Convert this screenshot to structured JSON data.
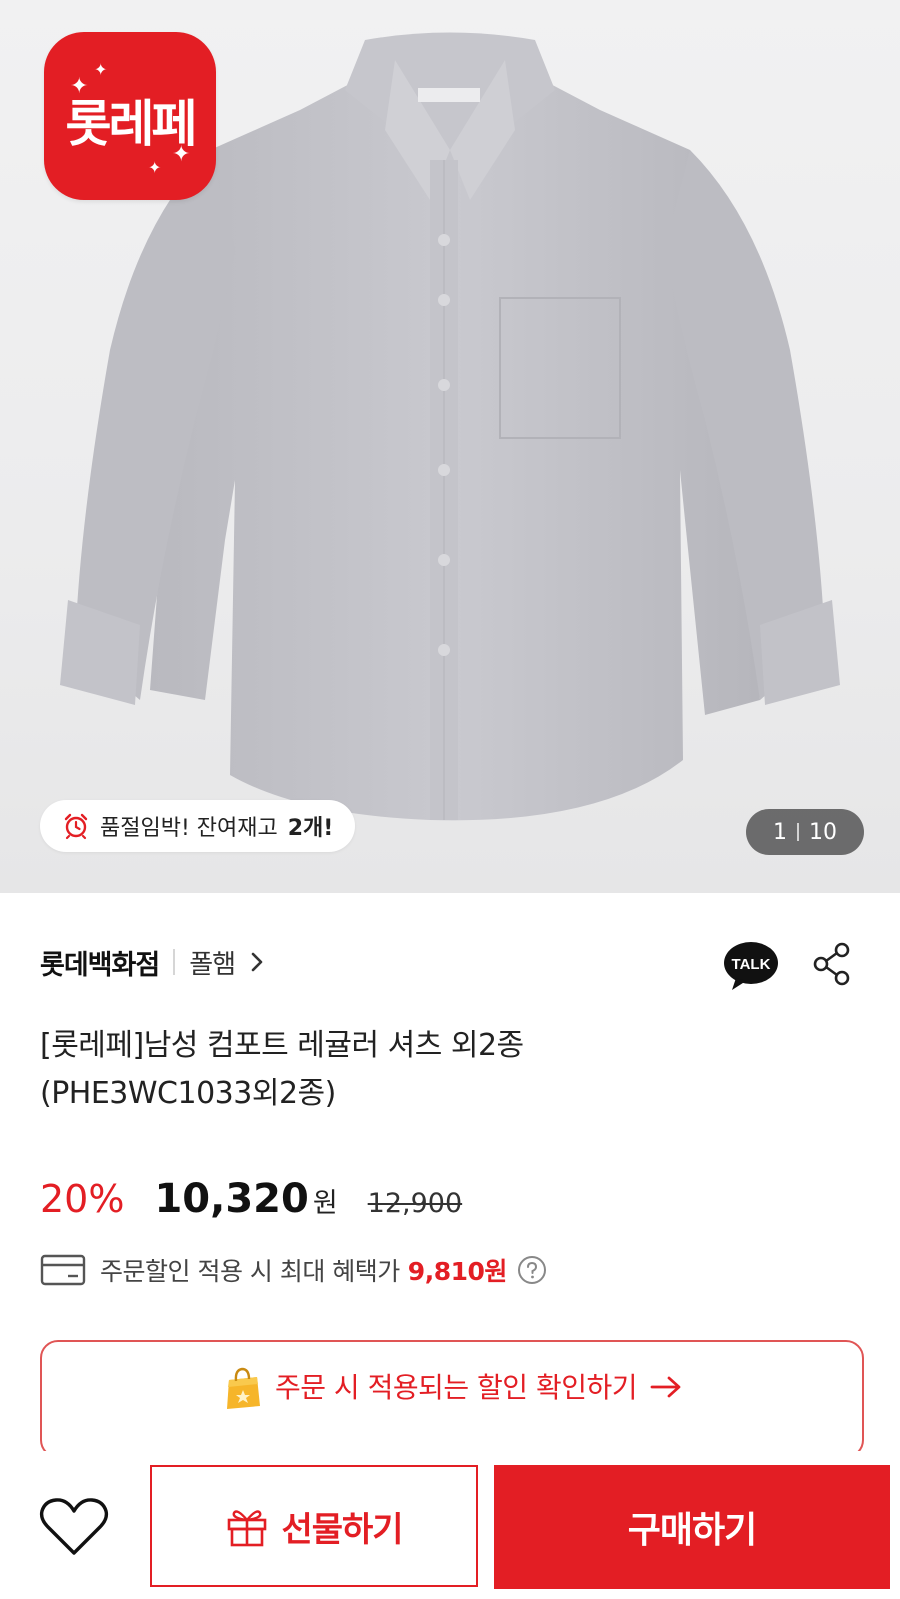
{
  "gallery": {
    "brand_badge": "롯레페",
    "stock_notice": {
      "prefix": "품절임박! 잔여재고",
      "count": "2개!"
    },
    "counter": {
      "current": "1",
      "total": "10"
    }
  },
  "store": {
    "name": "롯데백화점",
    "brand": "폴햄"
  },
  "product": {
    "title_line1": "[롯레페]남성 컴포트 레귤러 셔츠 외2종",
    "title_line2": "(PHE3WC1033외2종)"
  },
  "price": {
    "discount_rate": "20%",
    "sale_price": "10,320",
    "currency": "원",
    "original_price": "12,900"
  },
  "benefit": {
    "text": "주문할인 적용 시 최대 혜택가",
    "amount": "9,810원"
  },
  "discount_check": {
    "label": "주문 시 적용되는 할인 확인하기"
  },
  "bottom_bar": {
    "gift_label": "선물하기",
    "buy_label": "구매하기"
  },
  "icons": {
    "talk": "kakao-talk-icon",
    "share": "share-icon",
    "alarm": "alarm-clock-icon",
    "card": "credit-card-icon",
    "help": "question-icon",
    "bag": "shopping-bag-icon",
    "gift": "gift-icon",
    "heart": "heart-icon"
  },
  "colors": {
    "accent": "#e31e24",
    "text": "#1a1a1a"
  }
}
